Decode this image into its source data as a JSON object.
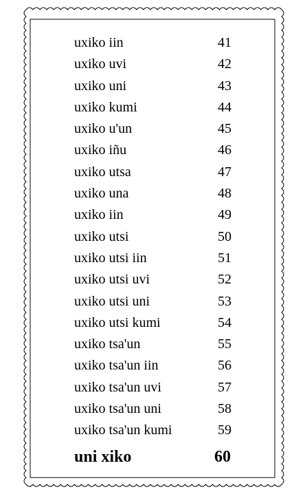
{
  "rows": [
    {
      "word": "uxiko iin",
      "number": "41"
    },
    {
      "word": "uxiko uvi",
      "number": "42"
    },
    {
      "word": "uxiko uni",
      "number": "43"
    },
    {
      "word": "uxiko kumi",
      "number": "44"
    },
    {
      "word": "uxiko u'un",
      "number": "45"
    },
    {
      "word": "uxiko iñu",
      "number": "46"
    },
    {
      "word": "uxiko utsa",
      "number": "47"
    },
    {
      "word": "uxiko una",
      "number": "48"
    },
    {
      "word": "uxiko iin",
      "number": "49"
    },
    {
      "word": "uxiko utsi",
      "number": "50"
    },
    {
      "word": "uxiko utsi iin",
      "number": "51"
    },
    {
      "word": "uxiko utsi uvi",
      "number": "52"
    },
    {
      "word": "uxiko utsi uni",
      "number": "53"
    },
    {
      "word": "uxiko utsi kumi",
      "number": "54"
    },
    {
      "word": "uxiko tsa'un",
      "number": "55"
    },
    {
      "word": "uxiko tsa'un iin",
      "number": "56"
    },
    {
      "word": "uxiko tsa'un uvi",
      "number": "57"
    },
    {
      "word": "uxiko tsa'un uni",
      "number": "58"
    },
    {
      "word": "uxiko tsa'un kumi",
      "number": "59"
    }
  ],
  "total": {
    "word": "uni xiko",
    "number": "60"
  },
  "colors": {
    "text": "#000000",
    "border": "#000000",
    "background": "#ffffff"
  }
}
